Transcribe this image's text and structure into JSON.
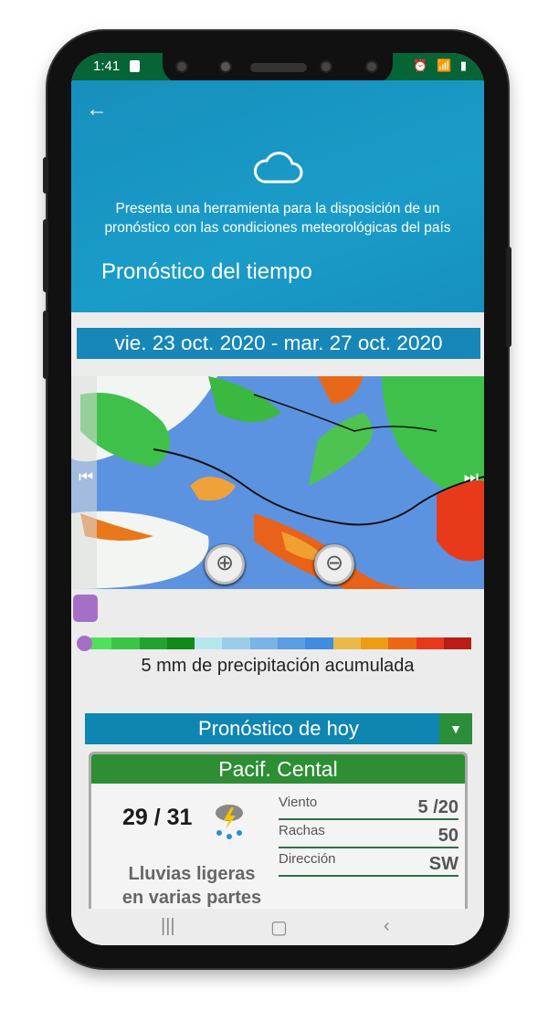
{
  "status": {
    "time": "1:41"
  },
  "header": {
    "description_line1": "Presenta una herramienta para la disposición de un",
    "description_line2": "pronóstico con las condiciones meteorológicas del país",
    "title": "Pronóstico del tiempo"
  },
  "date_range": "vie. 23 oct. 2020 - mar. 27 oct. 2020",
  "legend": {
    "text": "5 mm de precipitación acumulada",
    "level": 0,
    "colors": [
      "#52e05c",
      "#3cc448",
      "#24a22f",
      "#118a1a",
      "#b6e6f0",
      "#99cdea",
      "#7ab3e6",
      "#5b9de3",
      "#3f8ce0",
      "#eab94a",
      "#ee9c12",
      "#ec6714",
      "#e8381b",
      "#b81e17"
    ]
  },
  "forecast": {
    "section_title": "Pronóstico de hoy",
    "region": "Pacif. Cental",
    "temperature": "29 / 31",
    "condition_line1": "Lluvias ligeras",
    "condition_line2": "en varias partes",
    "rows": [
      {
        "label": "Viento",
        "value": "5 /20"
      },
      {
        "label": "Rachas",
        "value": "50"
      },
      {
        "label": "Dirección",
        "value": "SW"
      }
    ]
  }
}
